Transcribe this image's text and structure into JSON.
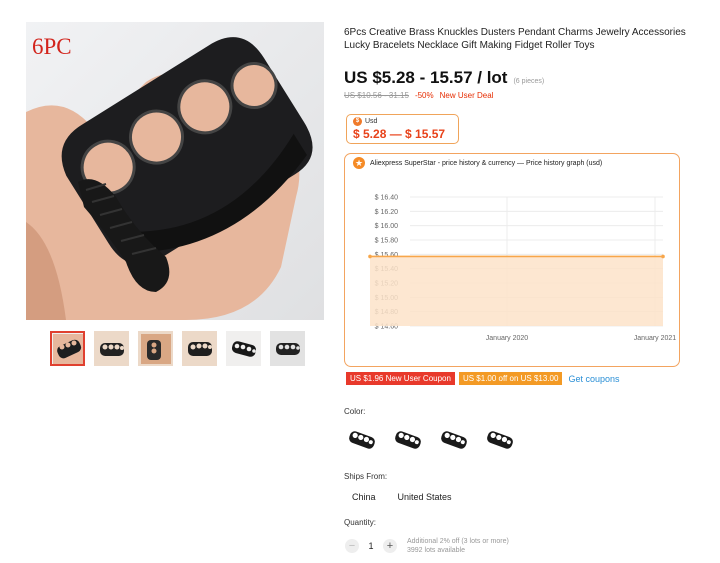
{
  "gallery": {
    "badge": "6PC",
    "thumbnails": [
      "thumb-1",
      "thumb-2",
      "thumb-3",
      "thumb-4",
      "thumb-5",
      "thumb-6"
    ],
    "active_index": 0
  },
  "product": {
    "title": "6Pcs Creative Brass Knuckles Dusters Pendant Charms Jewelry Accessories Lucky Bracelets Necklace Gift Making Fidget Roller Toys",
    "price": "US $5.28 - 15.57 / lot",
    "pieces": "(6 pieces)",
    "old_price": "US $10.56 - 31.15",
    "discount": "-50%",
    "deal": "New User Deal"
  },
  "currency_box": {
    "label": "Usd",
    "price": "$ 5.28 — $ 15.57"
  },
  "price_history": {
    "header": "Aliexpress SuperStar - price history & currency — Price history graph (usd)",
    "accent_color": "#f7a64a"
  },
  "chart_data": {
    "type": "area",
    "title": "",
    "xlabel": "",
    "ylabel": "",
    "y_ticks": [
      "$ 16.40",
      "$ 16.20",
      "$ 16.00",
      "$ 15.80",
      "$ 15.60",
      "$ 15.40",
      "$ 15.20",
      "$ 15.00",
      "$ 14.80",
      "$ 14.60"
    ],
    "y_tick_values": [
      16.4,
      16.2,
      16.0,
      15.8,
      15.6,
      15.4,
      15.2,
      15.0,
      14.8,
      14.6
    ],
    "ylim": [
      14.6,
      16.4
    ],
    "x_ticks": [
      "January 2020",
      "January 2021"
    ],
    "series": [
      {
        "x": [
          "start",
          "end"
        ],
        "values": [
          15.57,
          15.57
        ]
      }
    ],
    "grid": true,
    "color": "#f7a64a"
  },
  "coupons": {
    "red": "US $1.96 New User Coupon",
    "orange": "US $1.00 off on US $13.00",
    "link": "Get coupons"
  },
  "color_section": {
    "label": "Color:",
    "options": [
      "color-1",
      "color-2",
      "color-3",
      "color-4"
    ]
  },
  "shipping": {
    "label": "Ships From:",
    "options": [
      "China",
      "United States"
    ]
  },
  "quantity": {
    "label": "Quantity:",
    "minus": "−",
    "value": "1",
    "plus": "+",
    "info_line1": "Additional 2% off (3 lots or more)",
    "info_line2": "3992 lots available"
  }
}
